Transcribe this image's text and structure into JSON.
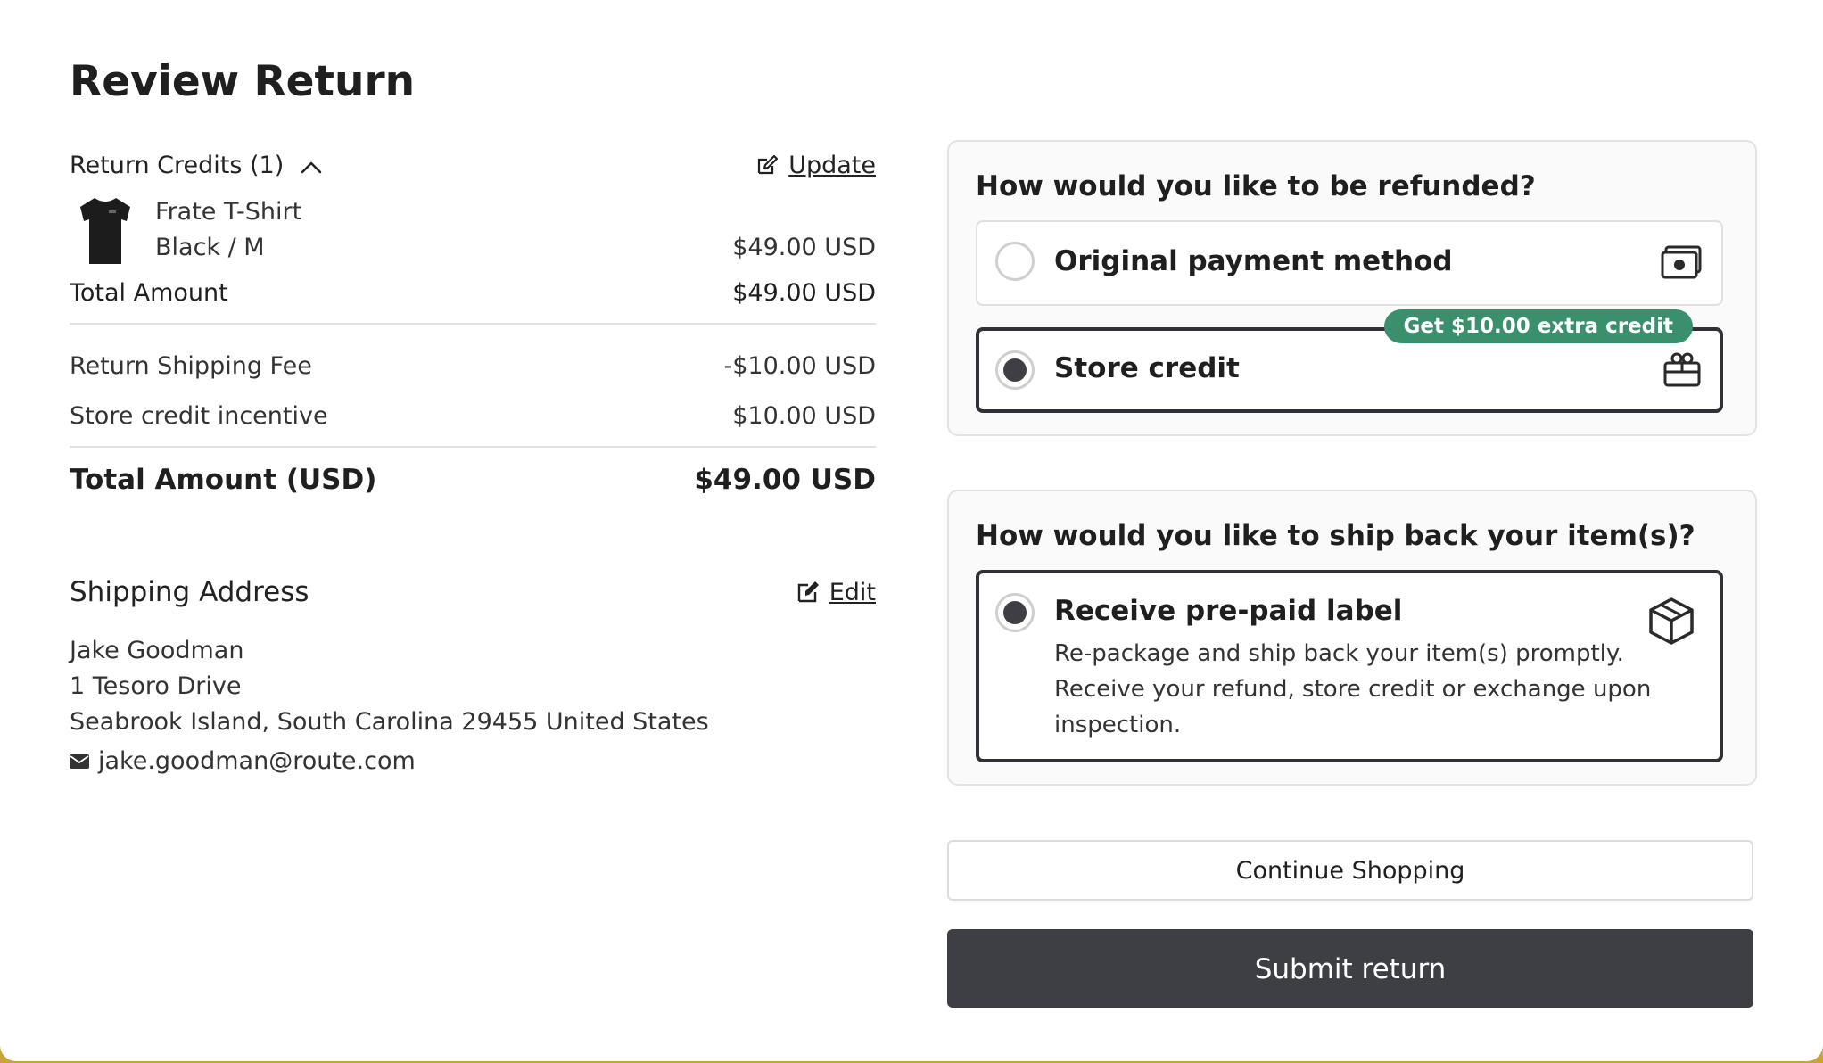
{
  "page": {
    "title": "Review Return"
  },
  "credits": {
    "heading": "Return Credits (1)",
    "update_label": "Update",
    "item": {
      "name": "Frate T-Shirt",
      "variant": "Black / M",
      "price": "$49.00 USD"
    },
    "total_label": "Total Amount",
    "total_value": "$49.00 USD",
    "fees": [
      {
        "label": "Return Shipping Fee",
        "value": "-$10.00 USD"
      },
      {
        "label": "Store credit incentive",
        "value": "$10.00 USD"
      }
    ],
    "grand_label": "Total Amount (USD)",
    "grand_value": "$49.00 USD"
  },
  "shipping": {
    "heading": "Shipping Address",
    "edit_label": "Edit",
    "name": "Jake Goodman",
    "street": "1 Tesoro Drive",
    "city": "Seabrook Island, South Carolina 29455 United States",
    "email": "jake.goodman@route.com"
  },
  "refund": {
    "question": "How would you like to be refunded?",
    "options": [
      {
        "label": "Original payment method",
        "icon": "cash-icon",
        "selected": false
      },
      {
        "label": "Store credit",
        "icon": "gift-card-icon",
        "selected": true,
        "badge": "Get $10.00 extra credit"
      }
    ]
  },
  "ship_method": {
    "question": "How would you like to ship back your item(s)?",
    "option": {
      "label": "Receive pre-paid label",
      "description": "Re-package and ship back your item(s) promptly. Receive your refund, store credit or exchange upon inspection.",
      "icon": "package-icon",
      "selected": true
    }
  },
  "actions": {
    "continue_label": "Continue Shopping",
    "submit_label": "Submit return"
  },
  "colors": {
    "primary": "#3d3f44",
    "badge": "#3a8f6d",
    "accent_frame": "#c9a23a"
  }
}
